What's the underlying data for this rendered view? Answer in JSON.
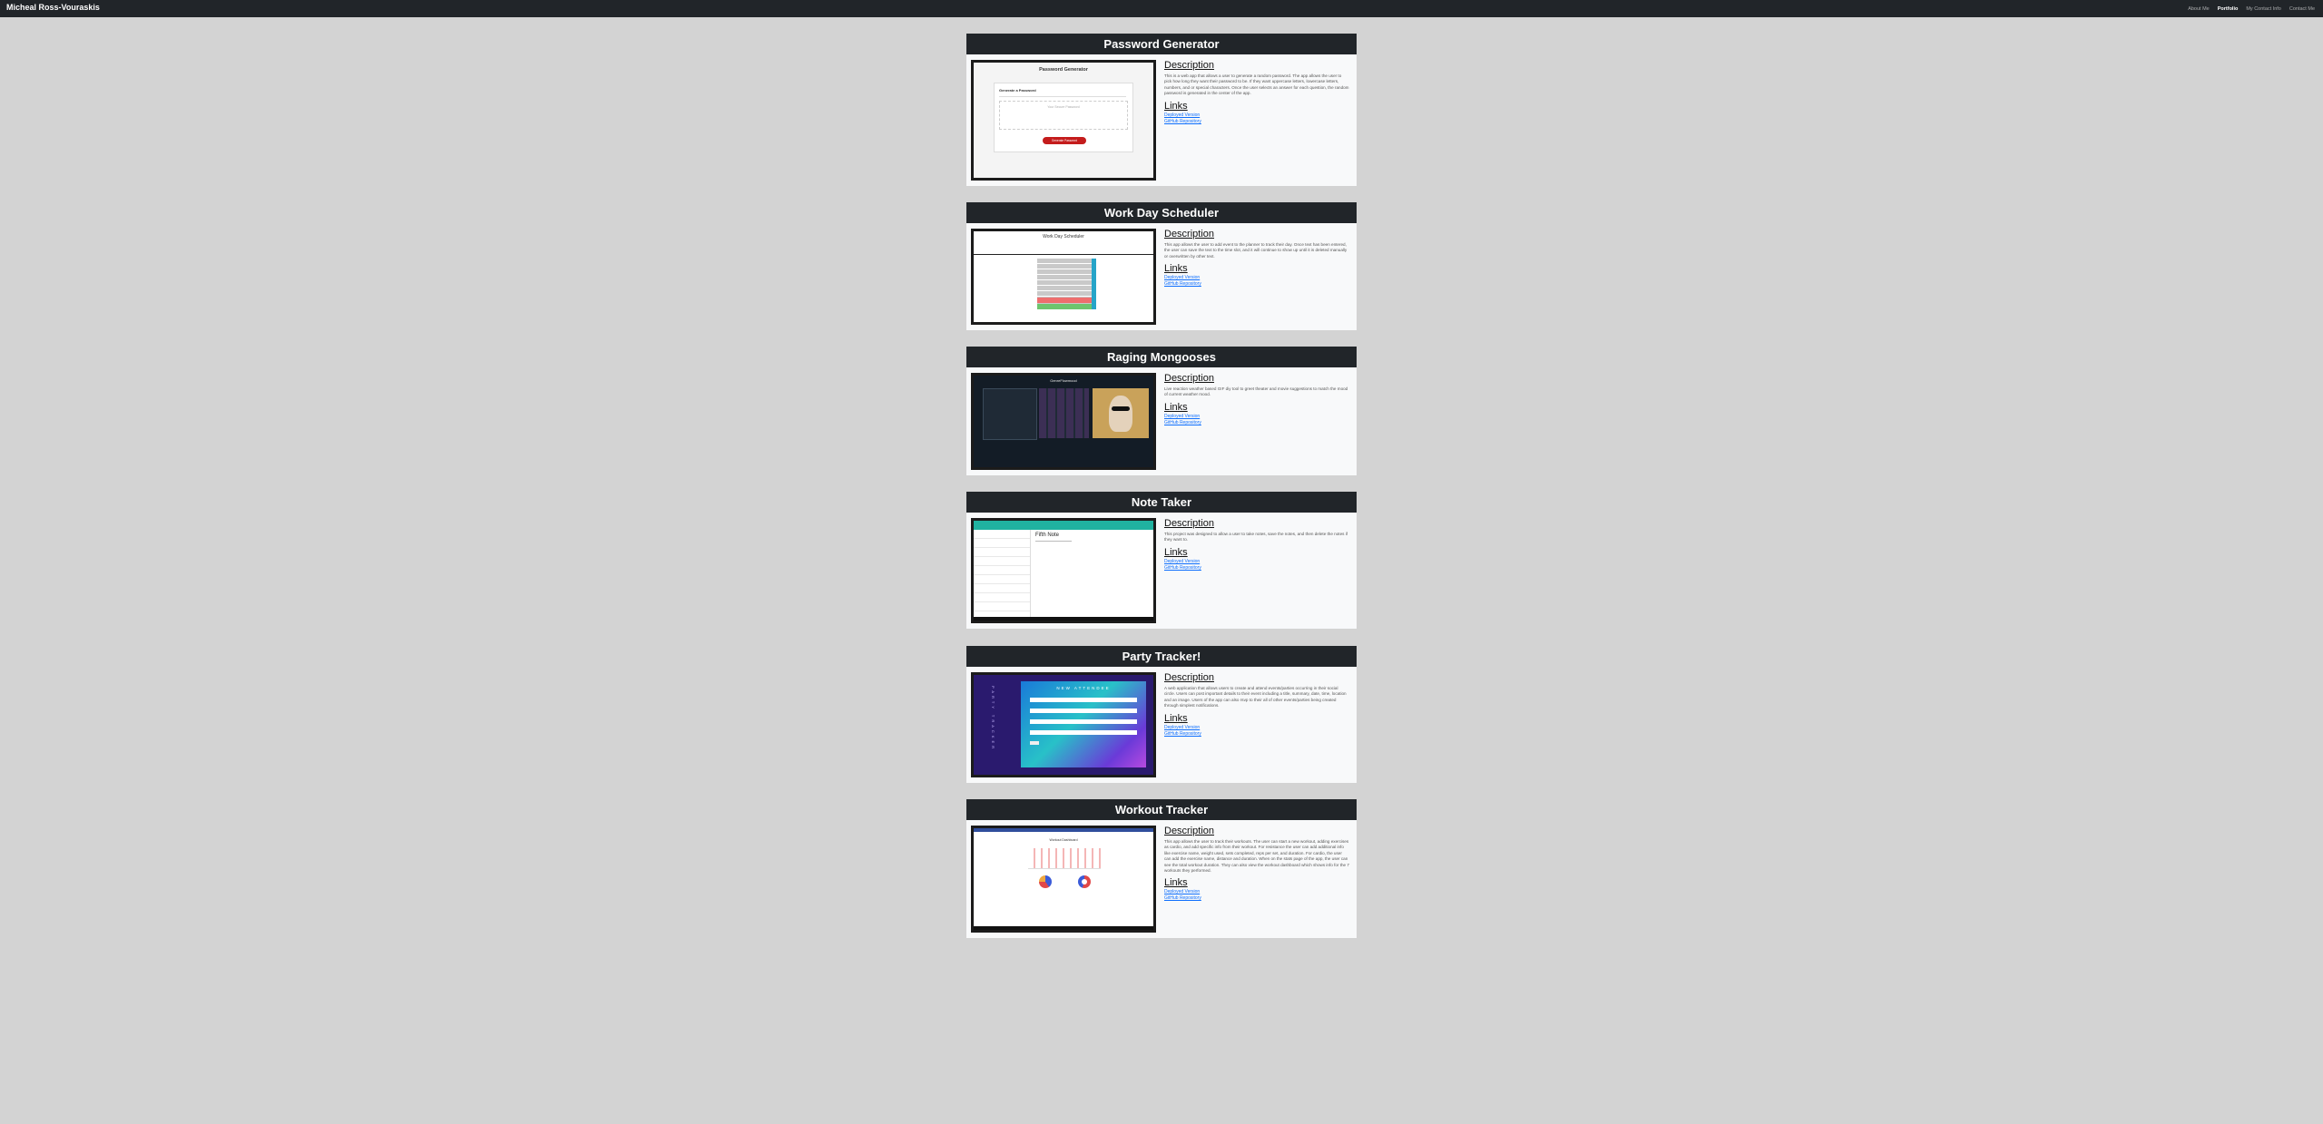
{
  "navbar": {
    "brand": "Micheal Ross-Vouraskis",
    "links": [
      {
        "label": "About Me"
      },
      {
        "label": "Portfolio"
      },
      {
        "label": "My Contact Info"
      },
      {
        "label": "Contact Me"
      }
    ]
  },
  "projects": [
    {
      "title": "Password Generator",
      "description_heading": "Description",
      "description": "This is a web app that allows a user to generate a random password. The app allows the user to pick how long they want their password to be. If they want uppercase letters, lowercase letters, numbers, and or special characters. Once the user selects an answer for each question, the random password is generated in the center of the app.",
      "links_heading": "Links",
      "link1": "Deployed Version",
      "link2": "GitHub Repository",
      "thumb": {
        "heading": "Password Generator",
        "subheading": "Generate a Password",
        "placeholder": "Your Secure Password",
        "button": "Generate Password"
      }
    },
    {
      "title": "Work Day Scheduler",
      "description_heading": "Description",
      "description": "This app allows the user to add event to the planner to track their day. Once text has been entered, the user can save the text to the time slot, and it will continue to show up until it is deleted manually or overwritten by other text.",
      "links_heading": "Links",
      "link1": "Deployed Version",
      "link2": "GitHub Repository",
      "thumb": {
        "heading": "Work Day Scheduler"
      }
    },
    {
      "title": "Raging Mongooses",
      "description_heading": "Description",
      "description": "Live reaction weather based GIF diy tool to greet theater and movie suggestions to match the mood of current weather mood.",
      "links_heading": "Links",
      "link1": "Deployed Version",
      "link2": "GitHub Repository",
      "thumb": {
        "heading": "GenreFlowmood"
      }
    },
    {
      "title": "Note Taker",
      "description_heading": "Description",
      "description": "This project was designed to allow a user to take notes, save the notes, and then delete the notes if they want to.",
      "links_heading": "Links",
      "link1": "Deployed Version",
      "link2": "GitHub Repository",
      "thumb": {
        "note_title": "Fifth Note"
      }
    },
    {
      "title": "Party Tracker!",
      "description_heading": "Description",
      "description": "A web application that allows users to create and attend events/parties occurring in their social circle. Users can post important details to their event including a title, summary, date, time, location and an image. Users of the app can also rsvp to their all of other events/parties being created through simplest notifications.",
      "links_heading": "Links",
      "link1": "Deployed Version",
      "link2": "GitHub Repository",
      "thumb": {
        "heading": "NEW ATTENDEE",
        "side": "PARTY TRACKER"
      }
    },
    {
      "title": "Workout Tracker",
      "description_heading": "Description",
      "description": "This app allows the user to track their workouts. The user can start a new workout, adding exercises as cardio, and add specific info from their workout. For resistance the user can add additional info like exercise name, weight used, sets completed, reps per set, and duration. For cardio, the user can add the exercise name, distance and duration. When on the stats page of the app, the user can see the total workout duration. They can also view the workout dashboard which shows info for the 7 workouts they performed.",
      "links_heading": "Links",
      "link1": "Deployed Version",
      "link2": "GitHub Repository",
      "thumb": {
        "heading": "Workout Dashboard"
      }
    }
  ]
}
